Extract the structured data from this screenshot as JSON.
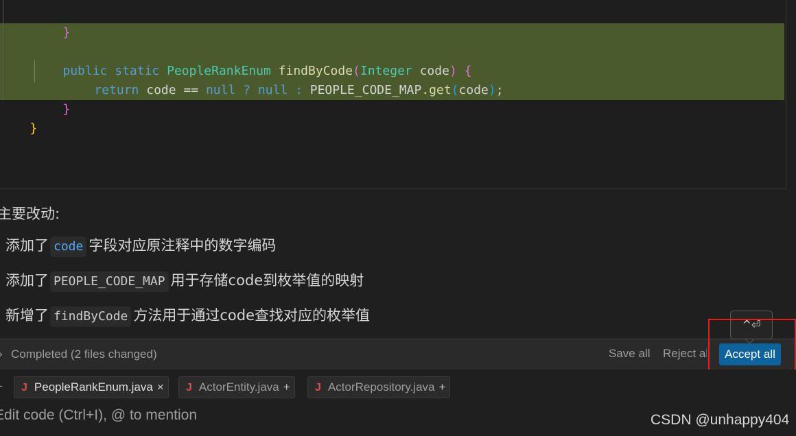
{
  "code": {
    "top_partial": "}",
    "signature": {
      "kw1": "public",
      "kw2": "static",
      "type": "PeopleRankEnum",
      "name": "findByCode",
      "param_type": "Integer",
      "param": "code"
    },
    "body": {
      "kw": "return",
      "left": "code",
      "op": "==",
      "null1": "null",
      "q": "?",
      "null2": "null",
      "colon": ":",
      "map": "PEOPLE_CODE_MAP",
      "get": ".get",
      "arg": "code",
      "end": ";"
    }
  },
  "chat": {
    "heading": "主要改动:",
    "bullets": [
      {
        "pre": "添加了",
        "code": "code",
        "post": "字段对应原注释中的数字编码"
      },
      {
        "pre": "添加了",
        "code": "PEOPLE_CODE_MAP",
        "post": "用于存储code到枚举值的映射"
      },
      {
        "pre": "新增了",
        "code": "findByCode",
        "post": "方法用于通过code查找对应的枚举值"
      }
    ]
  },
  "toolbar": {
    "status": "Completed (2 files changed)",
    "save_all": "Save all",
    "reject_all": "Reject all",
    "accept_all": "Accept all",
    "tooltip": "^⏎"
  },
  "files": [
    {
      "icon": "J",
      "name": "PeopleRankEnum.java",
      "action": "×"
    },
    {
      "icon": "J",
      "name": "ActorEntity.java",
      "action": "+"
    },
    {
      "icon": "J",
      "name": "ActorRepository.java",
      "action": "+"
    }
  ],
  "input": {
    "placeholder": "Edit code (Ctrl+I), @ to mention"
  },
  "watermark": "CSDN @unhappy404",
  "colors": {
    "accent": "#0e639c",
    "highlight": "#4b5a2c",
    "annotation": "#e02020"
  }
}
